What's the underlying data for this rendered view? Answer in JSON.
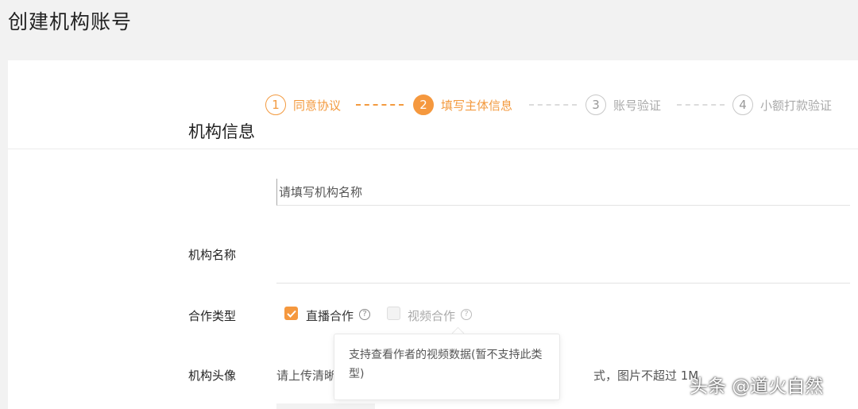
{
  "page": {
    "title": "创建机构账号"
  },
  "steps": [
    {
      "num": "1",
      "label": "同意协议",
      "state": "done"
    },
    {
      "num": "2",
      "label": "填写主体信息",
      "state": "active"
    },
    {
      "num": "3",
      "label": "账号验证",
      "state": "pending"
    },
    {
      "num": "4",
      "label": "小额打款验证",
      "state": "pending"
    }
  ],
  "form": {
    "section_title": "机构信息",
    "name": {
      "label": "机构名称",
      "placeholder": "请填写机构名称",
      "value": ""
    },
    "coop_type": {
      "label": "合作类型",
      "options": [
        {
          "label": "直播合作",
          "checked": true,
          "disabled": false
        },
        {
          "label": "视频合作",
          "checked": false,
          "disabled": true
        }
      ]
    },
    "avatar": {
      "label": "机构头像",
      "hint_visible_left": "请上传清晰",
      "hint_visible_right": "式，图片不超过 1M"
    }
  },
  "tooltip": {
    "text": "支持查看作者的视频数据(暂不支持此类型)"
  },
  "watermark": {
    "text": "头条 @道火自然"
  },
  "colors": {
    "accent": "#f5983e",
    "background": "#f2f2f2"
  }
}
